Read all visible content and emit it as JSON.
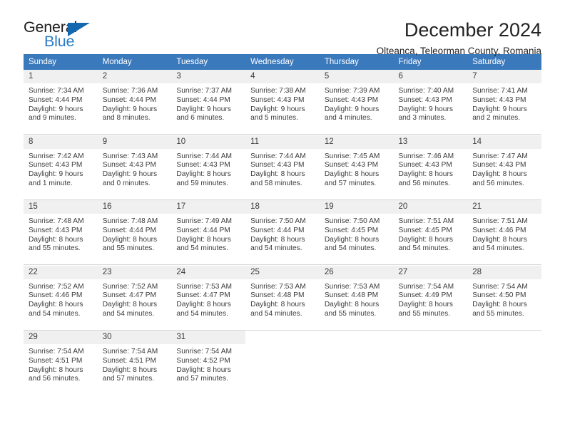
{
  "brand": {
    "name_top": "General",
    "name_bottom": "Blue",
    "triangle_color": "#1368b0",
    "blue_color": "#2b7cc4"
  },
  "header": {
    "title": "December 2024",
    "subtitle": "Olteanca, Teleorman County, Romania"
  },
  "theme": {
    "header_bg": "#3b79bd",
    "daynum_bg": "#f0f0f0",
    "text": "#3c3c3c",
    "rule": "#d6d6d6"
  },
  "weekday_headers": [
    "Sunday",
    "Monday",
    "Tuesday",
    "Wednesday",
    "Thursday",
    "Friday",
    "Saturday"
  ],
  "weeks": [
    [
      {
        "day": "1",
        "sunrise": "Sunrise: 7:34 AM",
        "sunset": "Sunset: 4:44 PM",
        "daylight1": "Daylight: 9 hours",
        "daylight2": "and 9 minutes."
      },
      {
        "day": "2",
        "sunrise": "Sunrise: 7:36 AM",
        "sunset": "Sunset: 4:44 PM",
        "daylight1": "Daylight: 9 hours",
        "daylight2": "and 8 minutes."
      },
      {
        "day": "3",
        "sunrise": "Sunrise: 7:37 AM",
        "sunset": "Sunset: 4:44 PM",
        "daylight1": "Daylight: 9 hours",
        "daylight2": "and 6 minutes."
      },
      {
        "day": "4",
        "sunrise": "Sunrise: 7:38 AM",
        "sunset": "Sunset: 4:43 PM",
        "daylight1": "Daylight: 9 hours",
        "daylight2": "and 5 minutes."
      },
      {
        "day": "5",
        "sunrise": "Sunrise: 7:39 AM",
        "sunset": "Sunset: 4:43 PM",
        "daylight1": "Daylight: 9 hours",
        "daylight2": "and 4 minutes."
      },
      {
        "day": "6",
        "sunrise": "Sunrise: 7:40 AM",
        "sunset": "Sunset: 4:43 PM",
        "daylight1": "Daylight: 9 hours",
        "daylight2": "and 3 minutes."
      },
      {
        "day": "7",
        "sunrise": "Sunrise: 7:41 AM",
        "sunset": "Sunset: 4:43 PM",
        "daylight1": "Daylight: 9 hours",
        "daylight2": "and 2 minutes."
      }
    ],
    [
      {
        "day": "8",
        "sunrise": "Sunrise: 7:42 AM",
        "sunset": "Sunset: 4:43 PM",
        "daylight1": "Daylight: 9 hours",
        "daylight2": "and 1 minute."
      },
      {
        "day": "9",
        "sunrise": "Sunrise: 7:43 AM",
        "sunset": "Sunset: 4:43 PM",
        "daylight1": "Daylight: 9 hours",
        "daylight2": "and 0 minutes."
      },
      {
        "day": "10",
        "sunrise": "Sunrise: 7:44 AM",
        "sunset": "Sunset: 4:43 PM",
        "daylight1": "Daylight: 8 hours",
        "daylight2": "and 59 minutes."
      },
      {
        "day": "11",
        "sunrise": "Sunrise: 7:44 AM",
        "sunset": "Sunset: 4:43 PM",
        "daylight1": "Daylight: 8 hours",
        "daylight2": "and 58 minutes."
      },
      {
        "day": "12",
        "sunrise": "Sunrise: 7:45 AM",
        "sunset": "Sunset: 4:43 PM",
        "daylight1": "Daylight: 8 hours",
        "daylight2": "and 57 minutes."
      },
      {
        "day": "13",
        "sunrise": "Sunrise: 7:46 AM",
        "sunset": "Sunset: 4:43 PM",
        "daylight1": "Daylight: 8 hours",
        "daylight2": "and 56 minutes."
      },
      {
        "day": "14",
        "sunrise": "Sunrise: 7:47 AM",
        "sunset": "Sunset: 4:43 PM",
        "daylight1": "Daylight: 8 hours",
        "daylight2": "and 56 minutes."
      }
    ],
    [
      {
        "day": "15",
        "sunrise": "Sunrise: 7:48 AM",
        "sunset": "Sunset: 4:43 PM",
        "daylight1": "Daylight: 8 hours",
        "daylight2": "and 55 minutes."
      },
      {
        "day": "16",
        "sunrise": "Sunrise: 7:48 AM",
        "sunset": "Sunset: 4:44 PM",
        "daylight1": "Daylight: 8 hours",
        "daylight2": "and 55 minutes."
      },
      {
        "day": "17",
        "sunrise": "Sunrise: 7:49 AM",
        "sunset": "Sunset: 4:44 PM",
        "daylight1": "Daylight: 8 hours",
        "daylight2": "and 54 minutes."
      },
      {
        "day": "18",
        "sunrise": "Sunrise: 7:50 AM",
        "sunset": "Sunset: 4:44 PM",
        "daylight1": "Daylight: 8 hours",
        "daylight2": "and 54 minutes."
      },
      {
        "day": "19",
        "sunrise": "Sunrise: 7:50 AM",
        "sunset": "Sunset: 4:45 PM",
        "daylight1": "Daylight: 8 hours",
        "daylight2": "and 54 minutes."
      },
      {
        "day": "20",
        "sunrise": "Sunrise: 7:51 AM",
        "sunset": "Sunset: 4:45 PM",
        "daylight1": "Daylight: 8 hours",
        "daylight2": "and 54 minutes."
      },
      {
        "day": "21",
        "sunrise": "Sunrise: 7:51 AM",
        "sunset": "Sunset: 4:46 PM",
        "daylight1": "Daylight: 8 hours",
        "daylight2": "and 54 minutes."
      }
    ],
    [
      {
        "day": "22",
        "sunrise": "Sunrise: 7:52 AM",
        "sunset": "Sunset: 4:46 PM",
        "daylight1": "Daylight: 8 hours",
        "daylight2": "and 54 minutes."
      },
      {
        "day": "23",
        "sunrise": "Sunrise: 7:52 AM",
        "sunset": "Sunset: 4:47 PM",
        "daylight1": "Daylight: 8 hours",
        "daylight2": "and 54 minutes."
      },
      {
        "day": "24",
        "sunrise": "Sunrise: 7:53 AM",
        "sunset": "Sunset: 4:47 PM",
        "daylight1": "Daylight: 8 hours",
        "daylight2": "and 54 minutes."
      },
      {
        "day": "25",
        "sunrise": "Sunrise: 7:53 AM",
        "sunset": "Sunset: 4:48 PM",
        "daylight1": "Daylight: 8 hours",
        "daylight2": "and 54 minutes."
      },
      {
        "day": "26",
        "sunrise": "Sunrise: 7:53 AM",
        "sunset": "Sunset: 4:48 PM",
        "daylight1": "Daylight: 8 hours",
        "daylight2": "and 55 minutes."
      },
      {
        "day": "27",
        "sunrise": "Sunrise: 7:54 AM",
        "sunset": "Sunset: 4:49 PM",
        "daylight1": "Daylight: 8 hours",
        "daylight2": "and 55 minutes."
      },
      {
        "day": "28",
        "sunrise": "Sunrise: 7:54 AM",
        "sunset": "Sunset: 4:50 PM",
        "daylight1": "Daylight: 8 hours",
        "daylight2": "and 55 minutes."
      }
    ],
    [
      {
        "day": "29",
        "sunrise": "Sunrise: 7:54 AM",
        "sunset": "Sunset: 4:51 PM",
        "daylight1": "Daylight: 8 hours",
        "daylight2": "and 56 minutes."
      },
      {
        "day": "30",
        "sunrise": "Sunrise: 7:54 AM",
        "sunset": "Sunset: 4:51 PM",
        "daylight1": "Daylight: 8 hours",
        "daylight2": "and 57 minutes."
      },
      {
        "day": "31",
        "sunrise": "Sunrise: 7:54 AM",
        "sunset": "Sunset: 4:52 PM",
        "daylight1": "Daylight: 8 hours",
        "daylight2": "and 57 minutes."
      },
      {
        "day": "",
        "sunrise": "",
        "sunset": "",
        "daylight1": "",
        "daylight2": ""
      },
      {
        "day": "",
        "sunrise": "",
        "sunset": "",
        "daylight1": "",
        "daylight2": ""
      },
      {
        "day": "",
        "sunrise": "",
        "sunset": "",
        "daylight1": "",
        "daylight2": ""
      },
      {
        "day": "",
        "sunrise": "",
        "sunset": "",
        "daylight1": "",
        "daylight2": ""
      }
    ]
  ]
}
